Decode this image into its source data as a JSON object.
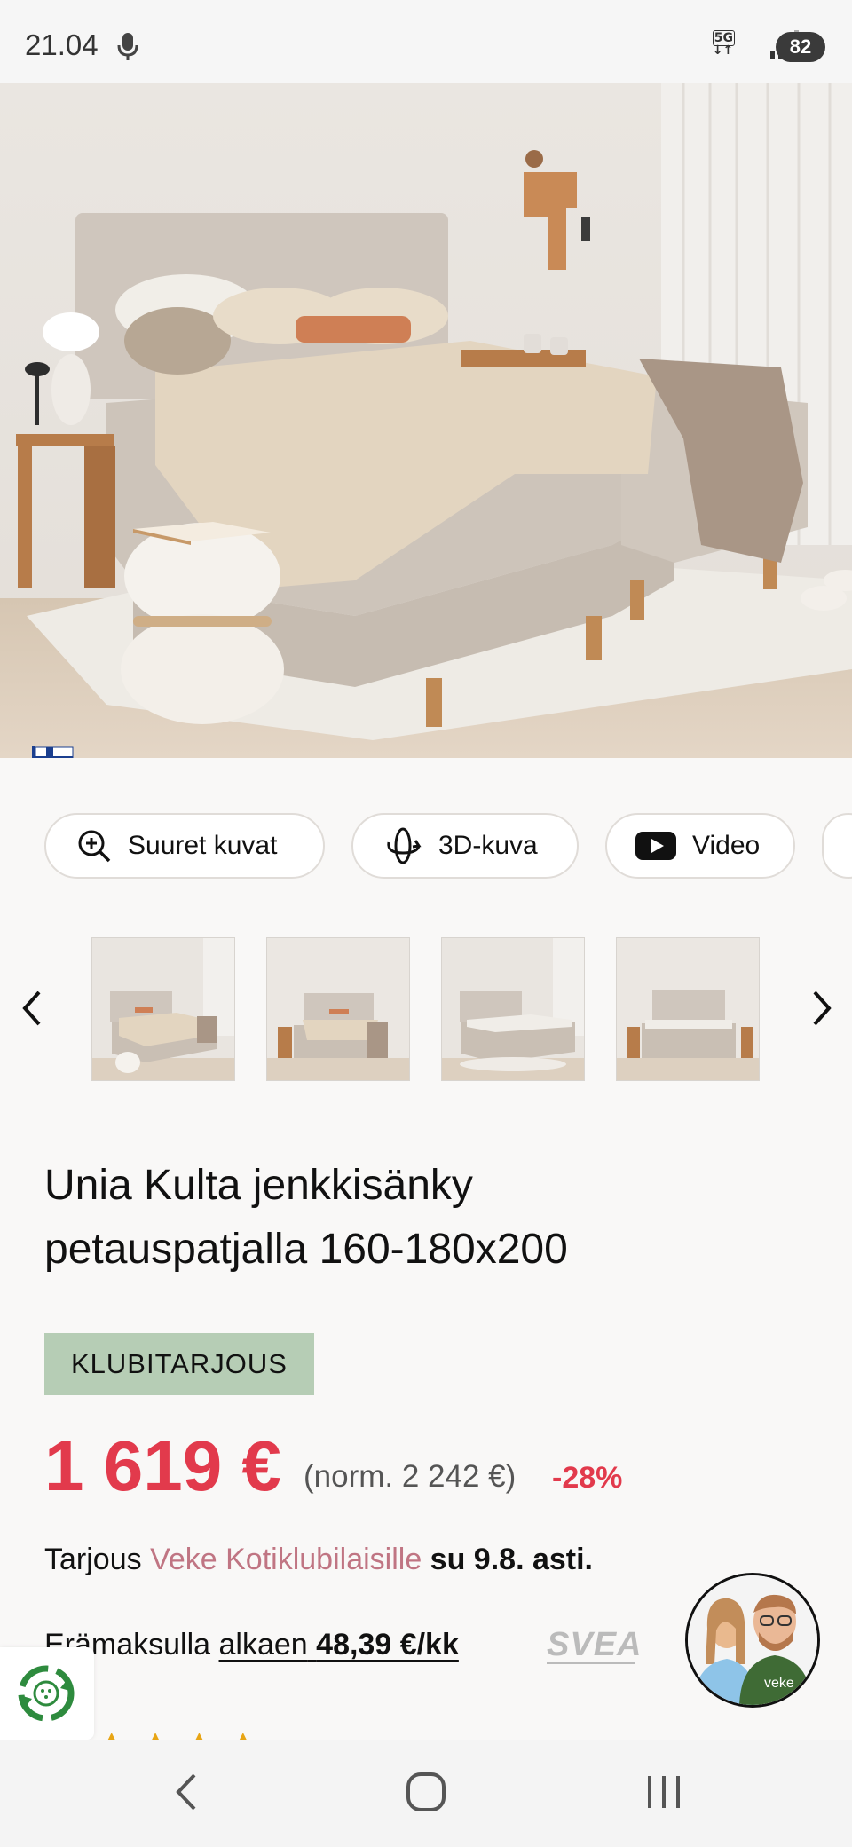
{
  "status_bar": {
    "time": "21.04",
    "network": "5G",
    "battery": "82"
  },
  "media_chips": [
    {
      "label": "Suuret kuvat",
      "icon": "zoom-in-icon"
    },
    {
      "label": "3D-kuva",
      "icon": "rotate-3d-icon"
    },
    {
      "label": "Video",
      "icon": "youtube-icon"
    }
  ],
  "product": {
    "title_line1": "Unia Kulta jenkkisänky",
    "title_line2": "petauspatjalla 160-180x200",
    "badge": "KLUBITARJOUS",
    "price": "1 619 €",
    "normal_price": "(norm. 2 242 €)",
    "discount": "-28%",
    "offer_prefix": "Tarjous ",
    "offer_link": "Veke Kotiklubilaisille",
    "offer_suffix": " su 9.8. asti.",
    "installment_prefix": "Erämaksulla ",
    "installment_link": "alkaen",
    "installment_amount": "48,39 €/kk",
    "installment_provider": "SVEA"
  },
  "colors": {
    "price_red": "#e23a4c",
    "badge_green": "#b6cdb5",
    "link_pink": "#c07583"
  }
}
